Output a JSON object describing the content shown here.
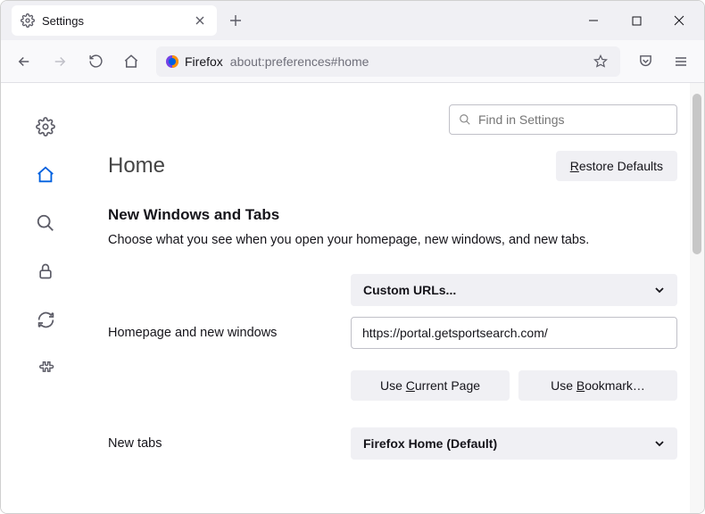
{
  "tab": {
    "label": "Settings"
  },
  "url": {
    "prefix": "Firefox",
    "path": "about:preferences#home"
  },
  "search": {
    "placeholder": "Find in Settings"
  },
  "page": {
    "title": "Home"
  },
  "buttons": {
    "restore": "Restore Defaults",
    "useCurrent": "Use Current Page",
    "useBookmark": "Use Bookmark…"
  },
  "section": {
    "title": "New Windows and Tabs",
    "desc": "Choose what you see when you open your homepage, new windows, and new tabs."
  },
  "form": {
    "homepageLabel": "Homepage and new windows",
    "homepageSelect": "Custom URLs...",
    "homepageUrl": "https://portal.getsportsearch.com/",
    "newTabsLabel": "New tabs",
    "newTabsSelect": "Firefox Home (Default)"
  }
}
